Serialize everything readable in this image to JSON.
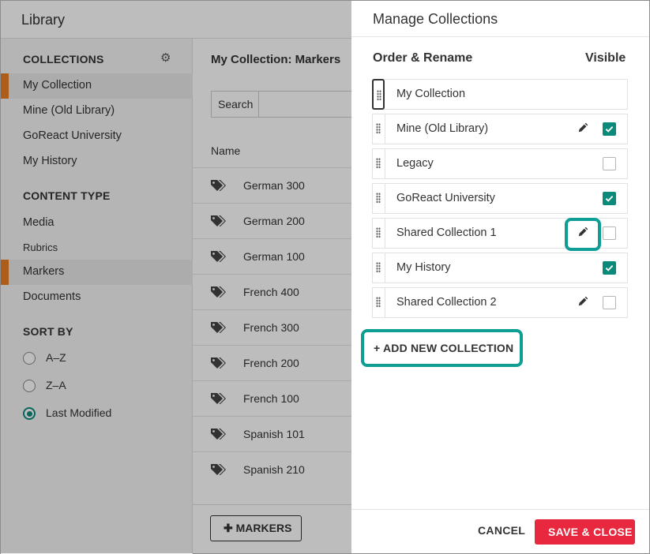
{
  "library": {
    "title": "Library",
    "collections_heading": "COLLECTIONS",
    "collections": [
      {
        "label": "My Collection",
        "active": true
      },
      {
        "label": "Mine (Old Library)",
        "active": false
      },
      {
        "label": "GoReact University",
        "active": false
      },
      {
        "label": "My History",
        "active": false
      }
    ],
    "content_type_heading": "CONTENT TYPE",
    "content_types": [
      {
        "label": "Media",
        "active": false
      },
      {
        "label": "Rubrics",
        "active": false
      },
      {
        "label": "Markers",
        "active": true
      },
      {
        "label": "Documents",
        "active": false
      }
    ],
    "sort_heading": "SORT BY",
    "sort_options": [
      {
        "label": "A–Z",
        "selected": false
      },
      {
        "label": "Z–A",
        "selected": false
      },
      {
        "label": "Last Modified",
        "selected": true
      }
    ],
    "content_title": "My Collection: Markers",
    "search_label": "Search",
    "column_name": "Name",
    "rows": [
      "German 300",
      "German 200",
      "German 100",
      "French 400",
      "French 300",
      "French 200",
      "French 100",
      "Spanish 101",
      "Spanish 210"
    ],
    "add_markers_label": "MARKERS",
    "accent_color": "#e87e22"
  },
  "panel": {
    "title": "Manage Collections",
    "order_header": "Order & Rename",
    "visible_header": "Visible",
    "collections": [
      {
        "name": "My Collection",
        "editable": false,
        "visible": null
      },
      {
        "name": "Mine (Old Library)",
        "editable": true,
        "visible": true
      },
      {
        "name": "Legacy",
        "editable": false,
        "visible": false
      },
      {
        "name": "GoReact University",
        "editable": false,
        "visible": true
      },
      {
        "name": "Shared Collection 1",
        "editable": true,
        "visible": false
      },
      {
        "name": "My History",
        "editable": false,
        "visible": true
      },
      {
        "name": "Shared Collection 2",
        "editable": true,
        "visible": false
      }
    ],
    "add_label": "+ ADD NEW COLLECTION",
    "cancel_label": "CANCEL",
    "save_label": "SAVE & CLOSE",
    "colors": {
      "check": "#0b8a7c",
      "highlight": "#0f9e96",
      "save": "#e8283f"
    },
    "icons": {
      "drag": "drag-handle-icon",
      "edit": "pencil-icon",
      "gear": "gear-icon",
      "tag": "tag-icon"
    }
  }
}
